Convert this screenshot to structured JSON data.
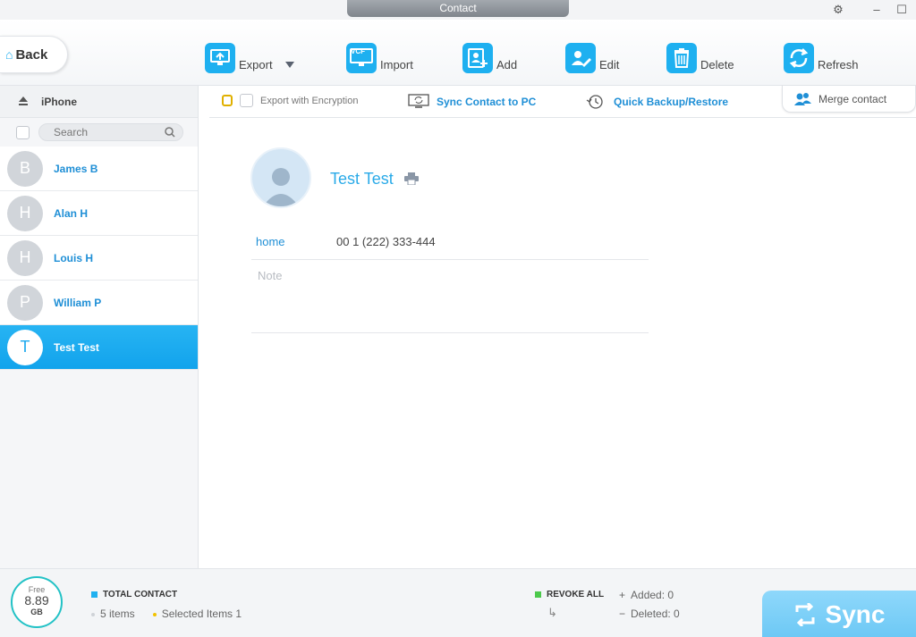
{
  "window": {
    "title": "Contact"
  },
  "toolbar": {
    "back_label": "Back",
    "export_label": "Export",
    "import_label": "Import",
    "add_label": "Add",
    "edit_label": "Edit",
    "delete_label": "Delete",
    "refresh_label": "Refresh",
    "vcf_badge": "VCF"
  },
  "sidebar": {
    "device_name": "iPhone",
    "search_placeholder": "Search",
    "contacts": [
      {
        "initial": "B",
        "name": "James B",
        "selected": false
      },
      {
        "initial": "H",
        "name": "Alan H",
        "selected": false
      },
      {
        "initial": "H",
        "name": "Louis H",
        "selected": false
      },
      {
        "initial": "P",
        "name": "William P",
        "selected": false
      },
      {
        "initial": "T",
        "name": "Test Test",
        "selected": true
      }
    ]
  },
  "subbar": {
    "export_encryption_label": "Export with Encryption",
    "sync_to_pc_label": "Sync Contact to PC",
    "backup_restore_label": "Quick Backup/Restore",
    "merge_label": "Merge contact"
  },
  "detail": {
    "name": "Test Test",
    "fields": [
      {
        "label": "home",
        "value": "00 1 (222) 333-444"
      }
    ],
    "note_placeholder": "Note"
  },
  "footer": {
    "storage_free_label": "Free",
    "storage_value": "8.89",
    "storage_unit": "GB",
    "total_label": "TOTAL CONTACT",
    "items_count": "5 items",
    "selected_items": "Selected Items 1",
    "revoke_label": "REVOKE ALL",
    "added_label": "Added: 0",
    "deleted_label": "Deleted: 0",
    "sync_label": "Sync"
  },
  "colors": {
    "accent": "#1eb0f0",
    "link": "#1f8fd6",
    "selected_row": "#16a6ee",
    "sync_button": "#7ccff7",
    "total_marker": "#1eb0f0",
    "revoke_marker": "#4cc94c",
    "selected_dot": "#f2c200"
  }
}
